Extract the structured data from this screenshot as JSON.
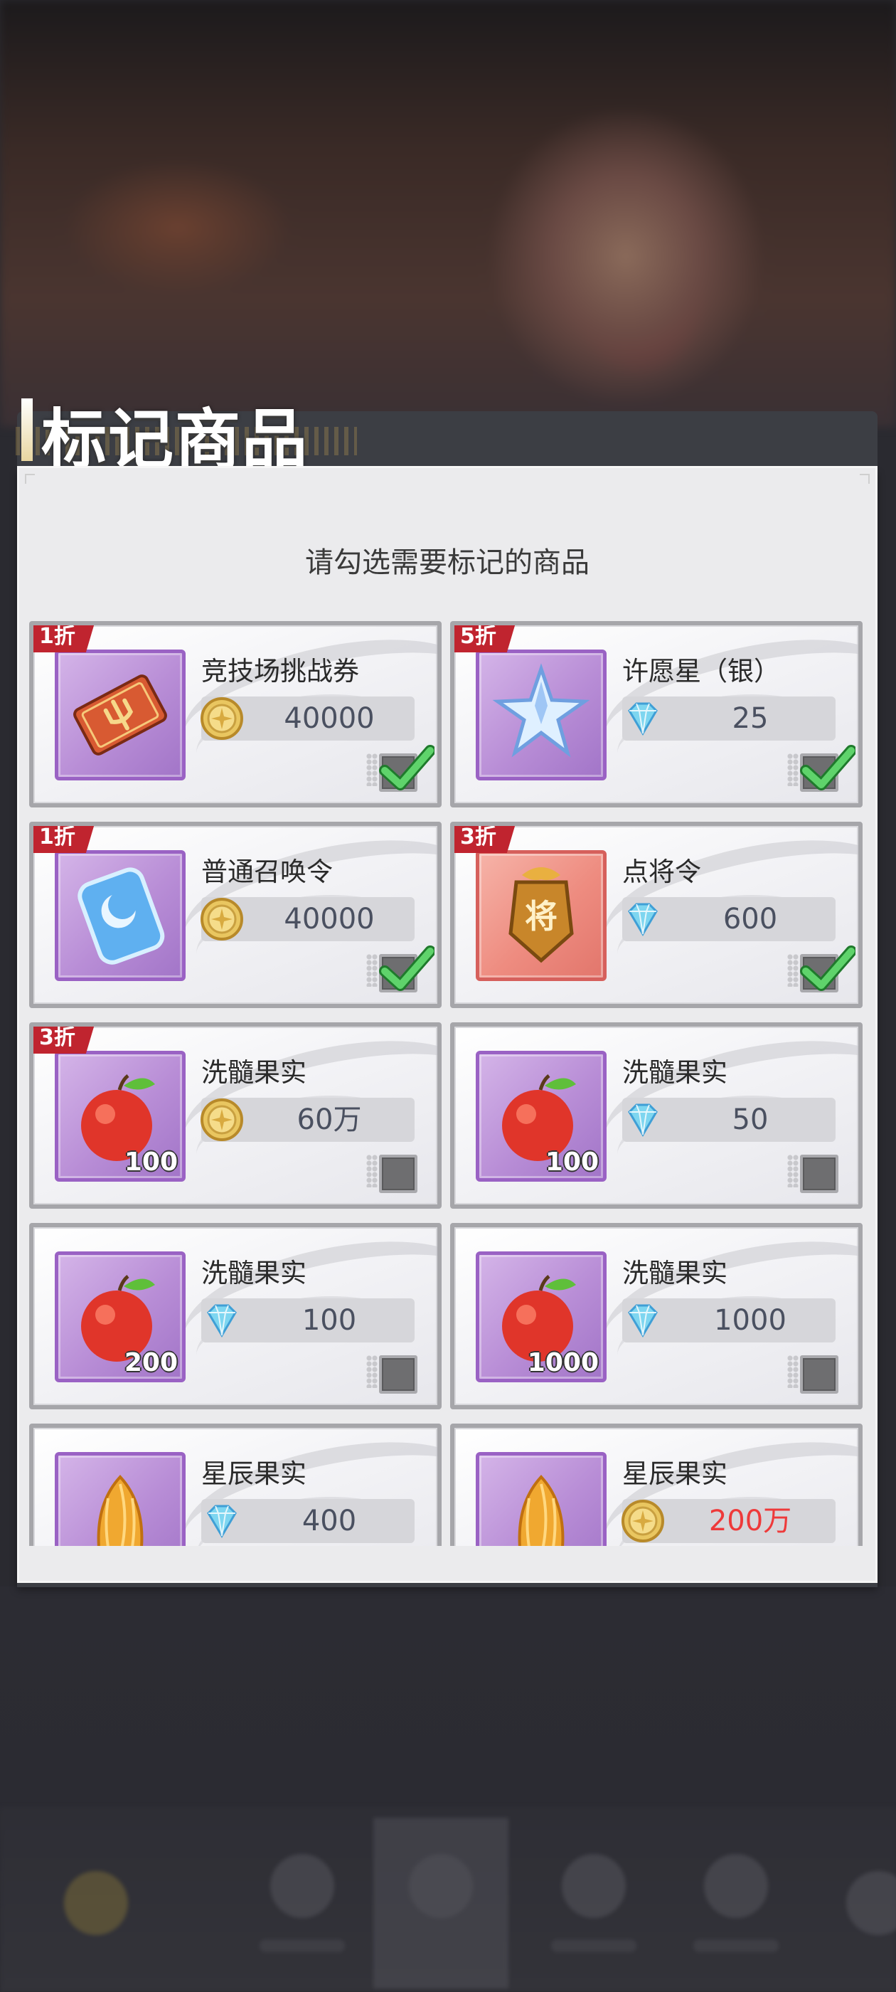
{
  "dialog": {
    "title": "标记商品",
    "subtitle": "请勾选需要标记的商品"
  },
  "items": [
    {
      "name": "竞技场挑战券",
      "discount": "1折",
      "price": "40000",
      "currency": "gold-coin-icon",
      "qty": "",
      "checked": true,
      "icon": "arena-ticket-icon",
      "frame": "purple",
      "price_color": "#4a5060"
    },
    {
      "name": "许愿星（银）",
      "discount": "5折",
      "price": "25",
      "currency": "diamond-icon",
      "qty": "",
      "checked": true,
      "icon": "silver-wish-star-icon",
      "frame": "purple",
      "price_color": "#4a5060"
    },
    {
      "name": "普通召唤令",
      "discount": "1折",
      "price": "40000",
      "currency": "gold-coin-icon",
      "qty": "",
      "checked": true,
      "icon": "summon-order-icon",
      "frame": "purple",
      "price_color": "#4a5060"
    },
    {
      "name": "点将令",
      "discount": "3折",
      "price": "600",
      "currency": "diamond-icon",
      "qty": "",
      "checked": true,
      "icon": "general-order-icon",
      "frame": "red",
      "price_color": "#4a5060"
    },
    {
      "name": "洗髓果实",
      "discount": "3折",
      "price": "60万",
      "currency": "gold-coin-icon",
      "qty": "100",
      "checked": false,
      "icon": "red-fruit-icon",
      "frame": "purple",
      "price_color": "#4a5060"
    },
    {
      "name": "洗髓果实",
      "discount": "",
      "price": "50",
      "currency": "diamond-icon",
      "qty": "100",
      "checked": false,
      "icon": "red-fruit-icon",
      "frame": "purple",
      "price_color": "#4a5060"
    },
    {
      "name": "洗髓果实",
      "discount": "",
      "price": "100",
      "currency": "diamond-icon",
      "qty": "200",
      "checked": false,
      "icon": "red-fruit-icon",
      "frame": "purple",
      "price_color": "#4a5060"
    },
    {
      "name": "洗髓果实",
      "discount": "",
      "price": "1000",
      "currency": "diamond-icon",
      "qty": "1000",
      "checked": false,
      "icon": "red-fruit-icon",
      "frame": "purple",
      "price_color": "#4a5060"
    },
    {
      "name": "星辰果实",
      "discount": "",
      "price": "400",
      "currency": "diamond-icon",
      "qty": "",
      "checked": false,
      "icon": "star-fruit-icon",
      "frame": "purple",
      "price_color": "#4a5060"
    },
    {
      "name": "星辰果实",
      "discount": "",
      "price": "200万",
      "currency": "gold-coin-icon",
      "qty": "",
      "checked": false,
      "icon": "star-fruit-icon",
      "frame": "purple",
      "price_color": "#ee3a3a"
    }
  ]
}
